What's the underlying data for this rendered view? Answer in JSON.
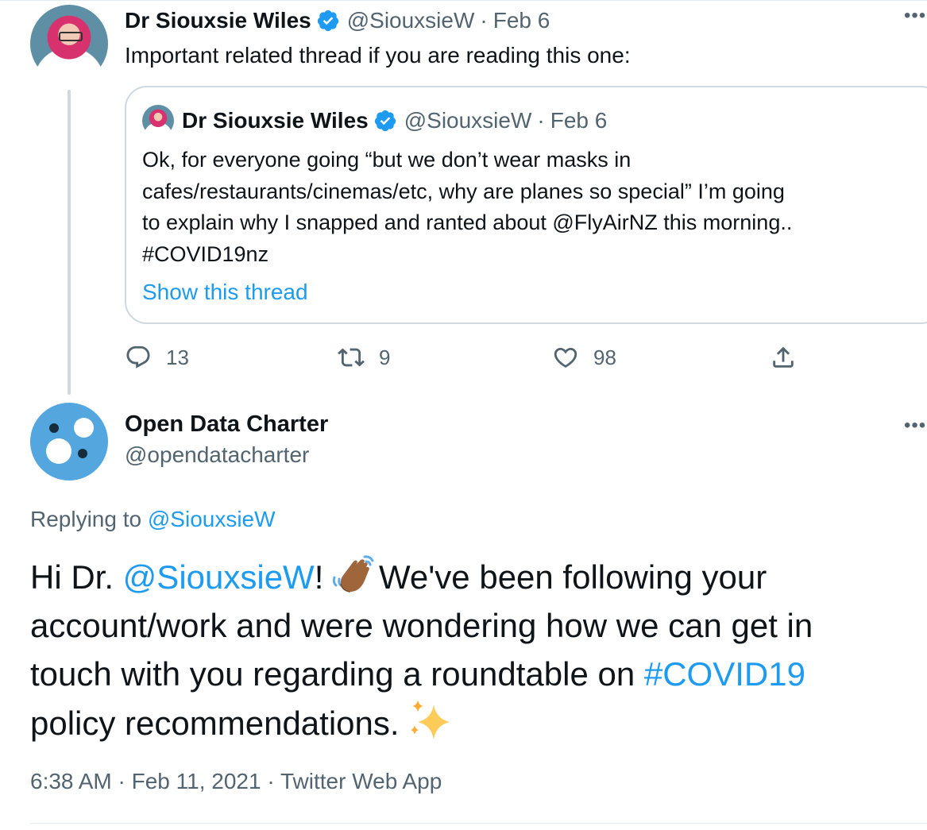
{
  "colors": {
    "accent": "#1d9bf0",
    "secondary_text": "#536471",
    "avatar_odc": "#54a7de"
  },
  "tweet1": {
    "name": "Dr Siouxsie Wiles",
    "handle": "@SiouxsieW",
    "separator": "·",
    "date": "Feb 6",
    "text": "Important related thread if you are reading this one:",
    "quoted": {
      "name": "Dr Siouxsie Wiles",
      "handle": "@SiouxsieW",
      "separator": "·",
      "date": "Feb 6",
      "text_lines": {
        "l1": "Ok, for everyone going “but we don’t wear masks in",
        "l2": "cafes/restaurants/cinemas/etc, why are planes so special” I’m going",
        "l3_pre": "to explain why I snapped and ranted about ",
        "l3_mention": "@FlyAirNZ",
        "l3_post": " this morning..",
        "l4": "#COVID19nz"
      },
      "show_thread": "Show this thread"
    },
    "actions": {
      "replies": "13",
      "retweets": "9",
      "likes": "98"
    }
  },
  "tweet2": {
    "name": "Open Data Charter",
    "handle": "@opendatacharter",
    "replying_label": "Replying to ",
    "replying_handle": "@SiouxsieW",
    "text": {
      "l1_pre": "Hi Dr. ",
      "l1_mention": "@SiouxsieW",
      "l1_bang": "!",
      "l1_post": "We've been following your",
      "l2": "account/work and were wondering how we can get in",
      "l3_pre": "touch with you regarding a roundtable on ",
      "l3_hashtag": "#COVID19",
      "l4": "policy recommendations."
    },
    "time": "6:38 AM",
    "separator": "·",
    "date": "Feb 11, 2021",
    "app": "Twitter Web App"
  },
  "icons": [
    "verified-badge-icon",
    "more-options-icon",
    "reply-icon",
    "retweet-icon",
    "like-icon",
    "share-icon",
    "waving-hand-emoji",
    "sparkles-emoji"
  ]
}
